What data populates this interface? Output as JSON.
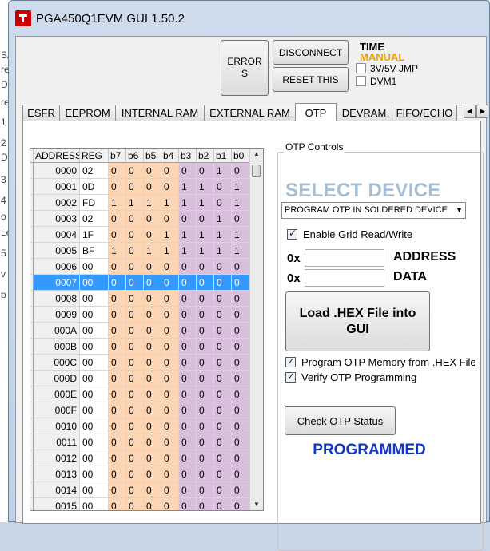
{
  "background_fragments": [
    "SA",
    "re",
    "Da",
    "re",
    "1",
    "2",
    "D",
    "3",
    "4",
    "o",
    "Le",
    "5",
    "v",
    "p"
  ],
  "window": {
    "title": "PGA450Q1EVM GUI  1.50.2"
  },
  "toolbar": {
    "errors_label": "ERRORS",
    "disconnect_label": "DISCONNECT",
    "reset_label": "RESET THIS",
    "time_label": "TIME",
    "manual_label": "MANUAL",
    "checkbox_1": "3V/5V JMP",
    "checkbox_2": "DVM1"
  },
  "tabs": [
    {
      "label": "ESFR"
    },
    {
      "label": "EEPROM"
    },
    {
      "label": "INTERNAL RAM"
    },
    {
      "label": "EXTERNAL RAM"
    },
    {
      "label": "OTP"
    },
    {
      "label": "DEVRAM"
    },
    {
      "label": "FIFO/ECHO"
    }
  ],
  "active_tab": "OTP",
  "grid": {
    "columns": [
      "ADDRESS",
      "REG",
      "b7",
      "b6",
      "b5",
      "b4",
      "b3",
      "b2",
      "b1",
      "b0"
    ],
    "selected_row": 7,
    "rows": [
      {
        "addr": "0000",
        "reg": "02",
        "bits": [
          "0",
          "0",
          "0",
          "0",
          "0",
          "0",
          "1",
          "0"
        ]
      },
      {
        "addr": "0001",
        "reg": "0D",
        "bits": [
          "0",
          "0",
          "0",
          "0",
          "1",
          "1",
          "0",
          "1"
        ]
      },
      {
        "addr": "0002",
        "reg": "FD",
        "bits": [
          "1",
          "1",
          "1",
          "1",
          "1",
          "1",
          "0",
          "1"
        ]
      },
      {
        "addr": "0003",
        "reg": "02",
        "bits": [
          "0",
          "0",
          "0",
          "0",
          "0",
          "0",
          "1",
          "0"
        ]
      },
      {
        "addr": "0004",
        "reg": "1F",
        "bits": [
          "0",
          "0",
          "0",
          "1",
          "1",
          "1",
          "1",
          "1"
        ]
      },
      {
        "addr": "0005",
        "reg": "BF",
        "bits": [
          "1",
          "0",
          "1",
          "1",
          "1",
          "1",
          "1",
          "1"
        ]
      },
      {
        "addr": "0006",
        "reg": "00",
        "bits": [
          "0",
          "0",
          "0",
          "0",
          "0",
          "0",
          "0",
          "0"
        ]
      },
      {
        "addr": "0007",
        "reg": "00",
        "bits": [
          "0",
          "0",
          "0",
          "0",
          "0",
          "0",
          "0",
          "0"
        ]
      },
      {
        "addr": "0008",
        "reg": "00",
        "bits": [
          "0",
          "0",
          "0",
          "0",
          "0",
          "0",
          "0",
          "0"
        ]
      },
      {
        "addr": "0009",
        "reg": "00",
        "bits": [
          "0",
          "0",
          "0",
          "0",
          "0",
          "0",
          "0",
          "0"
        ]
      },
      {
        "addr": "000A",
        "reg": "00",
        "bits": [
          "0",
          "0",
          "0",
          "0",
          "0",
          "0",
          "0",
          "0"
        ]
      },
      {
        "addr": "000B",
        "reg": "00",
        "bits": [
          "0",
          "0",
          "0",
          "0",
          "0",
          "0",
          "0",
          "0"
        ]
      },
      {
        "addr": "000C",
        "reg": "00",
        "bits": [
          "0",
          "0",
          "0",
          "0",
          "0",
          "0",
          "0",
          "0"
        ]
      },
      {
        "addr": "000D",
        "reg": "00",
        "bits": [
          "0",
          "0",
          "0",
          "0",
          "0",
          "0",
          "0",
          "0"
        ]
      },
      {
        "addr": "000E",
        "reg": "00",
        "bits": [
          "0",
          "0",
          "0",
          "0",
          "0",
          "0",
          "0",
          "0"
        ]
      },
      {
        "addr": "000F",
        "reg": "00",
        "bits": [
          "0",
          "0",
          "0",
          "0",
          "0",
          "0",
          "0",
          "0"
        ]
      },
      {
        "addr": "0010",
        "reg": "00",
        "bits": [
          "0",
          "0",
          "0",
          "0",
          "0",
          "0",
          "0",
          "0"
        ]
      },
      {
        "addr": "0011",
        "reg": "00",
        "bits": [
          "0",
          "0",
          "0",
          "0",
          "0",
          "0",
          "0",
          "0"
        ]
      },
      {
        "addr": "0012",
        "reg": "00",
        "bits": [
          "0",
          "0",
          "0",
          "0",
          "0",
          "0",
          "0",
          "0"
        ]
      },
      {
        "addr": "0013",
        "reg": "00",
        "bits": [
          "0",
          "0",
          "0",
          "0",
          "0",
          "0",
          "0",
          "0"
        ]
      },
      {
        "addr": "0014",
        "reg": "00",
        "bits": [
          "0",
          "0",
          "0",
          "0",
          "0",
          "0",
          "0",
          "0"
        ]
      },
      {
        "addr": "0015",
        "reg": "00",
        "bits": [
          "0",
          "0",
          "0",
          "0",
          "0",
          "0",
          "0",
          "0"
        ]
      }
    ]
  },
  "otp": {
    "group_title": "OTP Controls",
    "select_device": "SELECT DEVICE",
    "device_combo_value": "PROGRAM OTP IN SOLDERED DEVICE",
    "enable_grid_label": "Enable Grid Read/Write",
    "enable_grid_checked": true,
    "hex_prefix_1": "0x",
    "hex_prefix_2": "0x",
    "address_label": "ADDRESS",
    "data_label": "DATA",
    "address_value": "",
    "data_value": "",
    "load_hex_label": "Load .HEX File into GUI",
    "program_otp_label": "Program OTP Memory from .HEX File",
    "program_otp_checked": true,
    "verify_label": "Verify OTP Programming",
    "verify_checked": true,
    "check_status_label": "Check OTP Status",
    "status_text": "PROGRAMMED"
  },
  "colors": {
    "bit_high_bg": "#fcd5b5",
    "bit_low_bg": "#d8c0dc",
    "selection": "#3399ff",
    "status_text": "#1537c8",
    "select_device_text": "#a7bfd4",
    "manual_text": "#f0a000"
  },
  "icons": {
    "app": "ti-logo-icon",
    "row_pointer": "triangle-right-icon",
    "scroll_up": "arrow-up-icon",
    "scroll_down": "arrow-down-icon",
    "tab_scroll_left": "arrow-left-icon",
    "tab_scroll_right": "arrow-right-icon",
    "combo_arrow": "chevron-down-icon"
  }
}
